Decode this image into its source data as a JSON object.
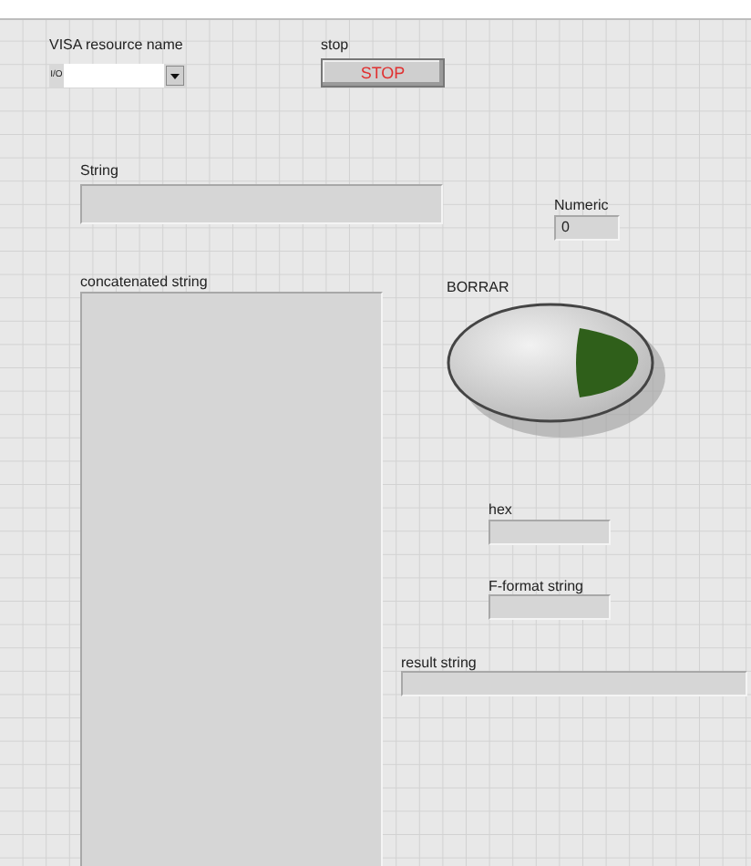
{
  "controls": [
    {
      "kind": "visa",
      "label": "VISA resource name",
      "icon_text": "I/O"
    },
    {
      "kind": "stop",
      "label": "stop",
      "text": "STOP"
    },
    {
      "kind": "string",
      "label": "String"
    },
    {
      "kind": "numeric",
      "label": "Numeric",
      "value": "0"
    },
    {
      "kind": "textarea",
      "label": "concatenated string"
    },
    {
      "kind": "round_button",
      "label": "BORRAR",
      "on": false
    },
    {
      "kind": "string_small",
      "label": "hex"
    },
    {
      "kind": "string_f",
      "label": "F-format string"
    },
    {
      "kind": "string_wide",
      "label": "result string"
    }
  ]
}
